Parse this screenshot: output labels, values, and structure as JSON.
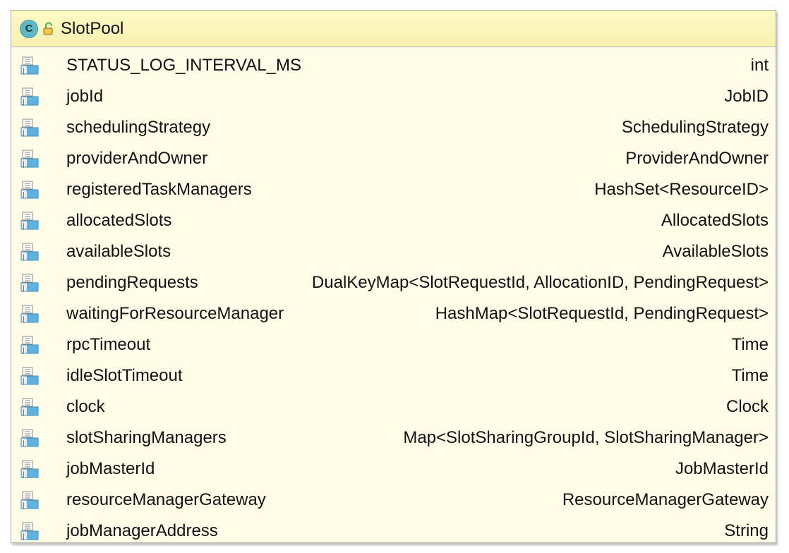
{
  "class_node": {
    "name": "SlotPool",
    "kind_badge": "C",
    "icons": {
      "kind": "class-icon",
      "visibility": "unlocked-icon",
      "field": "field-icon"
    },
    "colors": {
      "header": "#f9f5bb",
      "body": "#fffde8",
      "badge": "#5fb8c8"
    }
  },
  "fields": [
    {
      "name": "STATUS_LOG_INTERVAL_MS",
      "type": "int"
    },
    {
      "name": "jobId",
      "type": "JobID"
    },
    {
      "name": "schedulingStrategy",
      "type": "SchedulingStrategy"
    },
    {
      "name": "providerAndOwner",
      "type": "ProviderAndOwner"
    },
    {
      "name": "registeredTaskManagers",
      "type": "HashSet<ResourceID>"
    },
    {
      "name": "allocatedSlots",
      "type": "AllocatedSlots"
    },
    {
      "name": "availableSlots",
      "type": "AvailableSlots"
    },
    {
      "name": "pendingRequests",
      "type": "DualKeyMap<SlotRequestId, AllocationID, PendingRequest>"
    },
    {
      "name": "waitingForResourceManager",
      "type": "HashMap<SlotRequestId, PendingRequest>"
    },
    {
      "name": "rpcTimeout",
      "type": "Time"
    },
    {
      "name": "idleSlotTimeout",
      "type": "Time"
    },
    {
      "name": "clock",
      "type": "Clock"
    },
    {
      "name": "slotSharingManagers",
      "type": "Map<SlotSharingGroupId, SlotSharingManager>"
    },
    {
      "name": "jobMasterId",
      "type": "JobMasterId"
    },
    {
      "name": "resourceManagerGateway",
      "type": "ResourceManagerGateway"
    },
    {
      "name": "jobManagerAddress",
      "type": "String"
    }
  ]
}
